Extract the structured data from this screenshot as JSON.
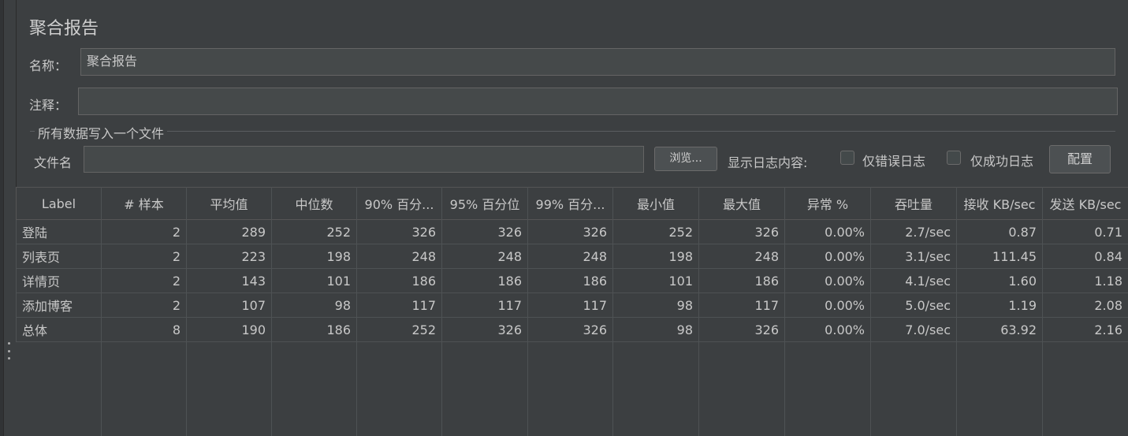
{
  "panel": {
    "title": "聚合报告",
    "name_label": "名称：",
    "name_value": "聚合报告",
    "comment_label": "注释：",
    "comment_value": ""
  },
  "file_group": {
    "title": "所有数据写入一个文件",
    "filename_label": "文件名",
    "filename_value": "",
    "browse_label": "浏览...",
    "log_content_label": "显示日志内容:",
    "errors_only_label": "仅错误日志",
    "success_only_label": "仅成功日志",
    "config_label": "配置"
  },
  "table": {
    "headers": [
      "Label",
      "# 样本",
      "平均值",
      "中位数",
      "90% 百分...",
      "95% 百分位",
      "99% 百分...",
      "最小值",
      "最大值",
      "异常 %",
      "吞吐量",
      "接收 KB/sec",
      "发送 KB/sec"
    ],
    "rows": [
      [
        "登陆",
        "2",
        "289",
        "252",
        "326",
        "326",
        "326",
        "252",
        "326",
        "0.00%",
        "2.7/sec",
        "0.87",
        "0.71"
      ],
      [
        "列表页",
        "2",
        "223",
        "198",
        "248",
        "248",
        "248",
        "198",
        "248",
        "0.00%",
        "3.1/sec",
        "111.45",
        "0.84"
      ],
      [
        "详情页",
        "2",
        "143",
        "101",
        "186",
        "186",
        "186",
        "101",
        "186",
        "0.00%",
        "4.1/sec",
        "1.60",
        "1.18"
      ],
      [
        "添加博客",
        "2",
        "107",
        "98",
        "117",
        "117",
        "117",
        "98",
        "117",
        "0.00%",
        "5.0/sec",
        "1.19",
        "2.08"
      ],
      [
        "总体",
        "8",
        "190",
        "186",
        "252",
        "326",
        "326",
        "98",
        "326",
        "0.00%",
        "7.0/sec",
        "63.92",
        "2.16"
      ]
    ]
  },
  "colors": {
    "background": "#3c3f41",
    "field_background": "#45494a",
    "text": "#c8c8c8",
    "border": "#646464"
  }
}
